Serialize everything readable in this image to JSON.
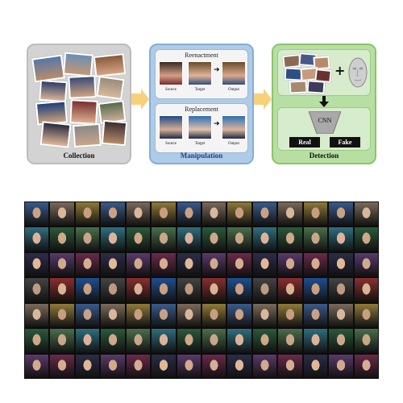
{
  "panels": {
    "collection": "Collection",
    "manipulation": "Manipulation",
    "detection": "Detection"
  },
  "reenactment": {
    "title": "Reenactment",
    "labels": [
      "Source",
      "Target",
      "Output"
    ]
  },
  "replacement": {
    "title": "Replacement",
    "labels": [
      "Source",
      "Target",
      "Output"
    ]
  },
  "detection": {
    "plus": "+",
    "cnn": "CNN",
    "real": "Real",
    "fake": "Fake"
  },
  "colors": {
    "collection_bg": "#d3d3d3",
    "manipulation_bg": "#aecbe8",
    "detection_bg": "#b7dea3",
    "arrow": "#f8d07a"
  },
  "icons": {
    "flow_arrow": "arrow-right",
    "down_arrow": "arrow-down",
    "face_model": "3d-face-mesh"
  }
}
